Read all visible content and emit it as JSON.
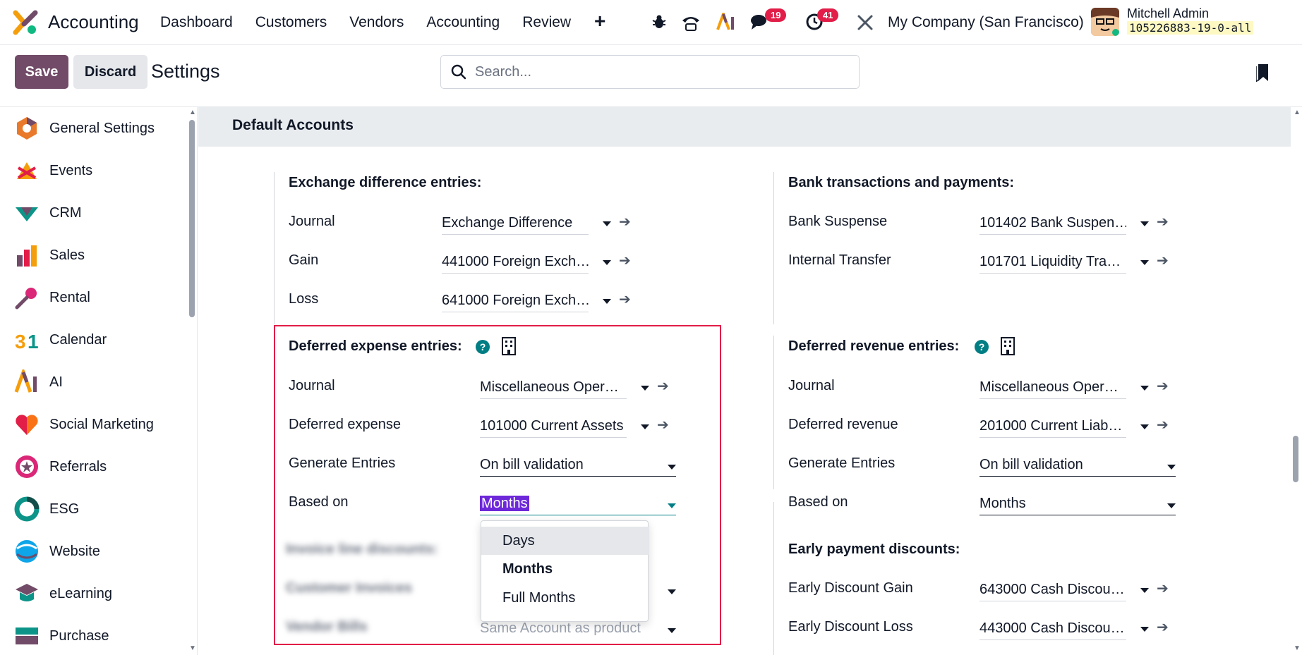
{
  "navbar": {
    "app_name": "Accounting",
    "menu": [
      "Dashboard",
      "Customers",
      "Vendors",
      "Accounting",
      "Review"
    ],
    "plus": "+",
    "chat_badge": "19",
    "activity_badge": "41",
    "company": "My Company (San Francisco)",
    "user_name": "Mitchell Admin",
    "db_name": "105226883-19-0-all"
  },
  "control": {
    "save_label": "Save",
    "discard_label": "Discard",
    "title": "Settings",
    "search_placeholder": "Search..."
  },
  "sidebar": {
    "items": [
      {
        "label": "General Settings",
        "icon": "general-settings-icon"
      },
      {
        "label": "Events",
        "icon": "events-icon"
      },
      {
        "label": "CRM",
        "icon": "crm-icon"
      },
      {
        "label": "Sales",
        "icon": "sales-icon"
      },
      {
        "label": "Rental",
        "icon": "rental-icon"
      },
      {
        "label": "Calendar",
        "icon": "calendar-icon"
      },
      {
        "label": "AI",
        "icon": "ai-icon"
      },
      {
        "label": "Social Marketing",
        "icon": "social-marketing-icon"
      },
      {
        "label": "Referrals",
        "icon": "referrals-icon"
      },
      {
        "label": "ESG",
        "icon": "esg-icon"
      },
      {
        "label": "Website",
        "icon": "website-icon"
      },
      {
        "label": "eLearning",
        "icon": "elearning-icon"
      },
      {
        "label": "Purchase",
        "icon": "purchase-icon"
      }
    ]
  },
  "section": {
    "title": "Default Accounts",
    "exchange": {
      "title": "Exchange difference entries:",
      "journal_label": "Journal",
      "journal_value": "Exchange Difference",
      "gain_label": "Gain",
      "gain_value": "441000 Foreign Exch…",
      "loss_label": "Loss",
      "loss_value": "641000 Foreign Exch…"
    },
    "bank": {
      "title": "Bank transactions and payments:",
      "suspense_label": "Bank Suspense",
      "suspense_value": "101402 Bank Suspen…",
      "transfer_label": "Internal Transfer",
      "transfer_value": "101701 Liquidity Tra…"
    },
    "deferred_expense": {
      "title": "Deferred expense entries:",
      "journal_label": "Journal",
      "journal_value": "Miscellaneous Oper…",
      "account_label": "Deferred expense",
      "account_value": "101000 Current Assets",
      "generate_label": "Generate Entries",
      "generate_value": "On bill validation",
      "based_label": "Based on",
      "based_value": "Months"
    },
    "deferred_revenue": {
      "title": "Deferred revenue entries:",
      "journal_label": "Journal",
      "journal_value": "Miscellaneous Oper…",
      "account_label": "Deferred revenue",
      "account_value": "201000 Current Liab…",
      "generate_label": "Generate Entries",
      "generate_value": "On bill validation",
      "based_label": "Based on",
      "based_value": "Months"
    },
    "blurred": {
      "line1": "Invoice line discounts:",
      "line2": "Customer Invoices",
      "line3": "Vendor Bills",
      "vendor_value": "Same Account as product"
    },
    "early": {
      "title": "Early payment discounts:",
      "gain_label": "Early Discount Gain",
      "gain_value": "643000 Cash Discou…",
      "loss_label": "Early Discount Loss",
      "loss_value": "443000 Cash Discou…"
    }
  },
  "dropdown": {
    "options": [
      "Days",
      "Months",
      "Full Months"
    ]
  },
  "colors": {
    "brand": "#714b67",
    "teal": "#017e84",
    "badge": "#e11d48",
    "highlight_box": "#e11d48"
  }
}
